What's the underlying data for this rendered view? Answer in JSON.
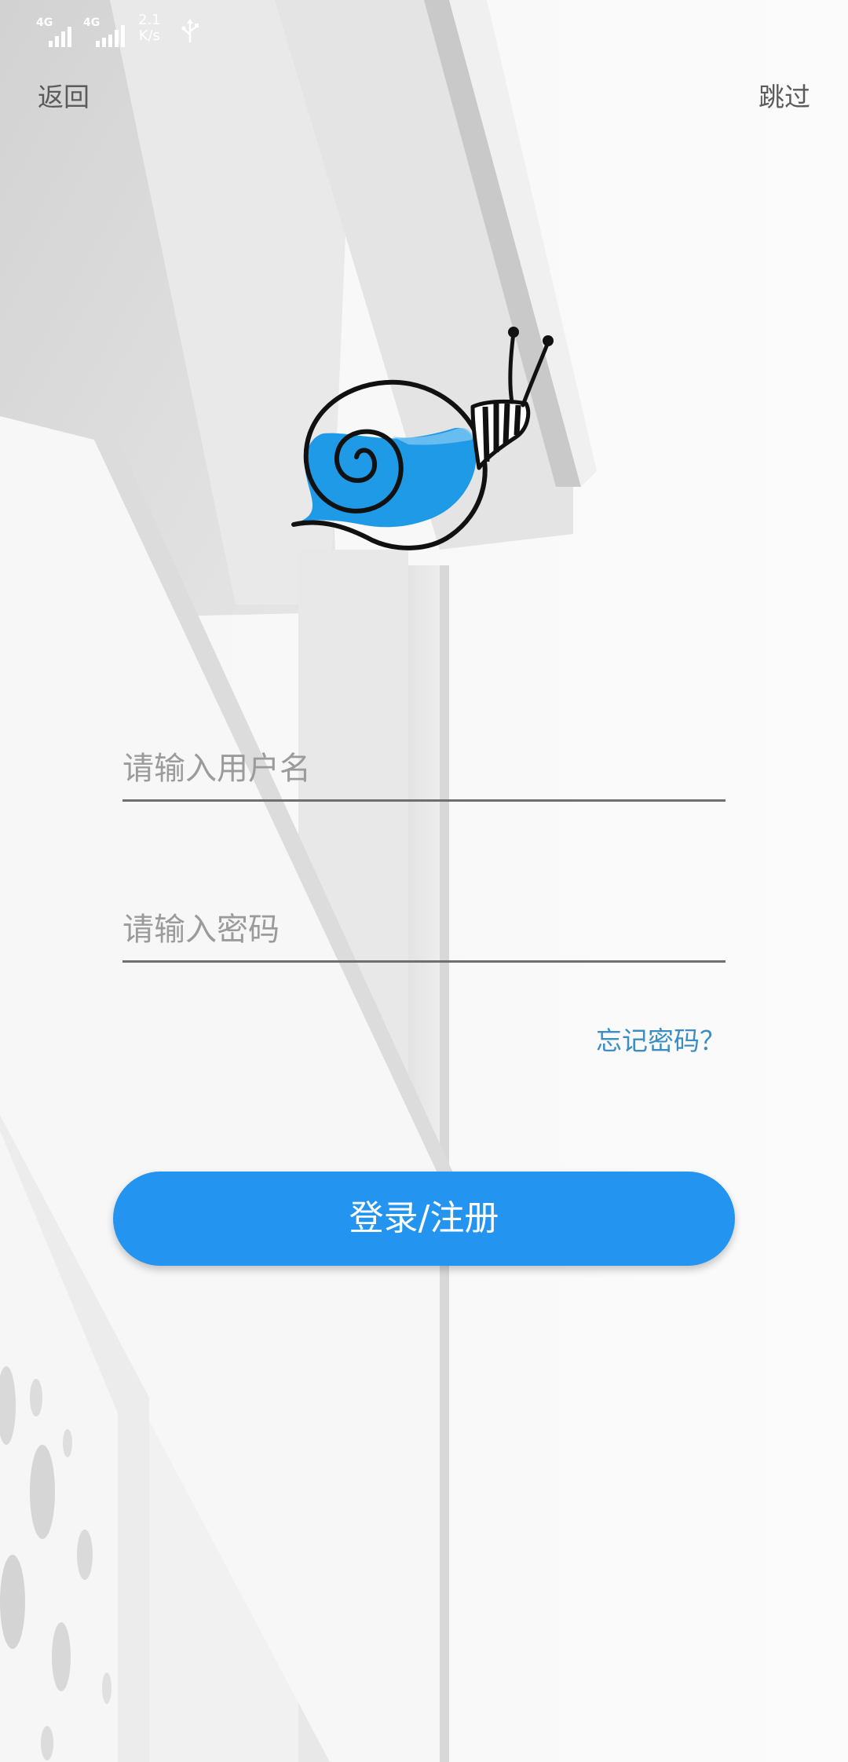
{
  "status_bar": {
    "sim1_network": "4G",
    "sim2_network": "4G",
    "speed_value": "2.1",
    "speed_unit": "K/s",
    "usb_icon": "usb-icon"
  },
  "header": {
    "back_label": "返回",
    "skip_label": "跳过"
  },
  "logo": {
    "icon": "snail-logo-icon"
  },
  "form": {
    "username_placeholder": "请输入用户名",
    "username_value": "",
    "password_placeholder": "请输入密码",
    "password_value": "",
    "forgot_label": "忘记密码？",
    "submit_label": "登录/注册"
  },
  "colors": {
    "accent": "#2394ef",
    "link": "#3a8ec4",
    "text_secondary": "#5b5b5b",
    "placeholder": "#9b9b9b",
    "snail_blue": "#1e9ae6"
  }
}
